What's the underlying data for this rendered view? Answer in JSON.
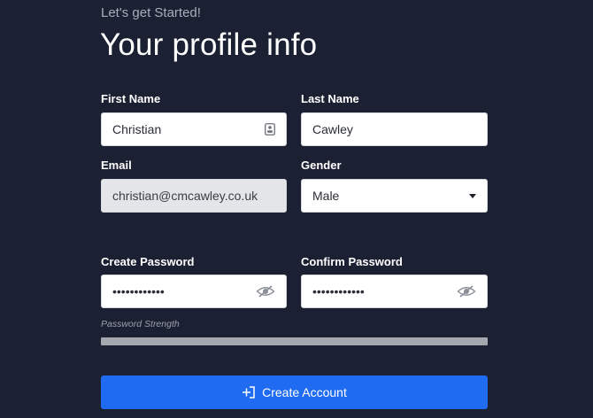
{
  "header": {
    "kicker": "Let's get Started!",
    "title": "Your profile info"
  },
  "form": {
    "first_name": {
      "label": "First Name",
      "value": "Christian",
      "icon": "contact-card-icon"
    },
    "last_name": {
      "label": "Last Name",
      "value": "Cawley"
    },
    "email": {
      "label": "Email",
      "value": "christian@cmcawley.co.uk",
      "disabled": true
    },
    "gender": {
      "label": "Gender",
      "value": "Male",
      "icon": "caret-down-icon"
    },
    "create_password": {
      "label": "Create Password",
      "value": "••••••••••••",
      "icon": "eye-off-icon"
    },
    "confirm_password": {
      "label": "Confirm Password",
      "value": "••••••••••••",
      "icon": "eye-off-icon"
    },
    "password_strength": {
      "label": "Password Strength",
      "level": 0
    }
  },
  "actions": {
    "create_account_label": "Create Account",
    "create_account_icon": "sign-in-icon"
  },
  "colors": {
    "background": "#1c2033",
    "primary": "#1f6bf2",
    "strength_track": "#a4a7ae",
    "disabled_field": "#e4e5e8"
  }
}
